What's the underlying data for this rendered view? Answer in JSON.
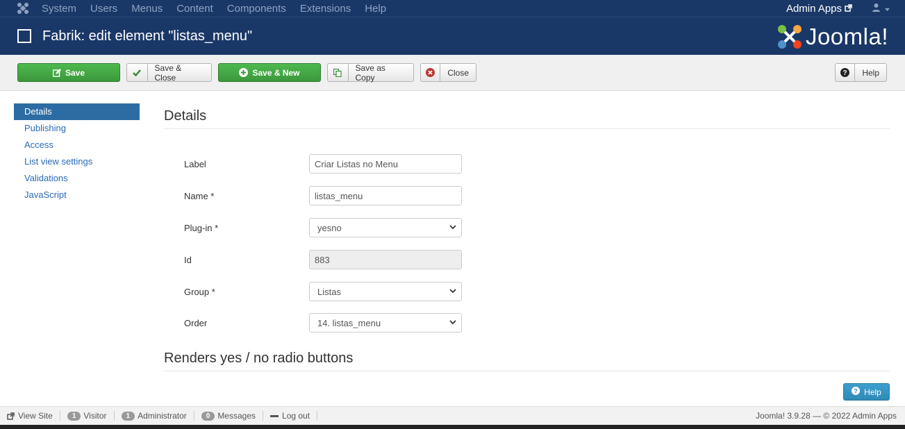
{
  "navbar": {
    "menu": [
      "System",
      "Users",
      "Menus",
      "Content",
      "Components",
      "Extensions",
      "Help"
    ],
    "admin_apps": "Admin Apps"
  },
  "header": {
    "title": "Fabrik: edit element \"listas_menu\"",
    "brand": "Joomla!"
  },
  "toolbar": {
    "save": "Save",
    "save_close": "Save & Close",
    "save_new": "Save & New",
    "save_copy": "Save as Copy",
    "close": "Close",
    "help": "Help"
  },
  "sidebar": {
    "items": [
      {
        "label": "Details"
      },
      {
        "label": "Publishing"
      },
      {
        "label": "Access"
      },
      {
        "label": "List view settings"
      },
      {
        "label": "Validations"
      },
      {
        "label": "JavaScript"
      }
    ]
  },
  "main": {
    "heading": "Details",
    "fields": {
      "label": {
        "label": "Label",
        "value": "Criar Listas no Menu"
      },
      "name": {
        "label": "Name *",
        "value": "listas_menu"
      },
      "plugin": {
        "label": "Plug-in *",
        "value": "yesno"
      },
      "id": {
        "label": "Id",
        "value": "883"
      },
      "group": {
        "label": "Group *",
        "value": "Listas"
      },
      "order": {
        "label": "Order",
        "value": "14. listas_menu"
      }
    },
    "plugin_heading": "Renders yes / no radio buttons",
    "help_button": "Help"
  },
  "statusbar": {
    "view_site": "View Site",
    "visitor_count": "1",
    "visitor": "Visitor",
    "admin_count": "1",
    "administrator": "Administrator",
    "messages_count": "0",
    "messages": "Messages",
    "logout": "Log out",
    "version": "Joomla! 3.9.28  —  © 2022 Admin Apps"
  },
  "colors": {
    "navy": "#1a3867",
    "green": "#46a546",
    "link": "#2a69b8",
    "active": "#2d6ca2"
  }
}
